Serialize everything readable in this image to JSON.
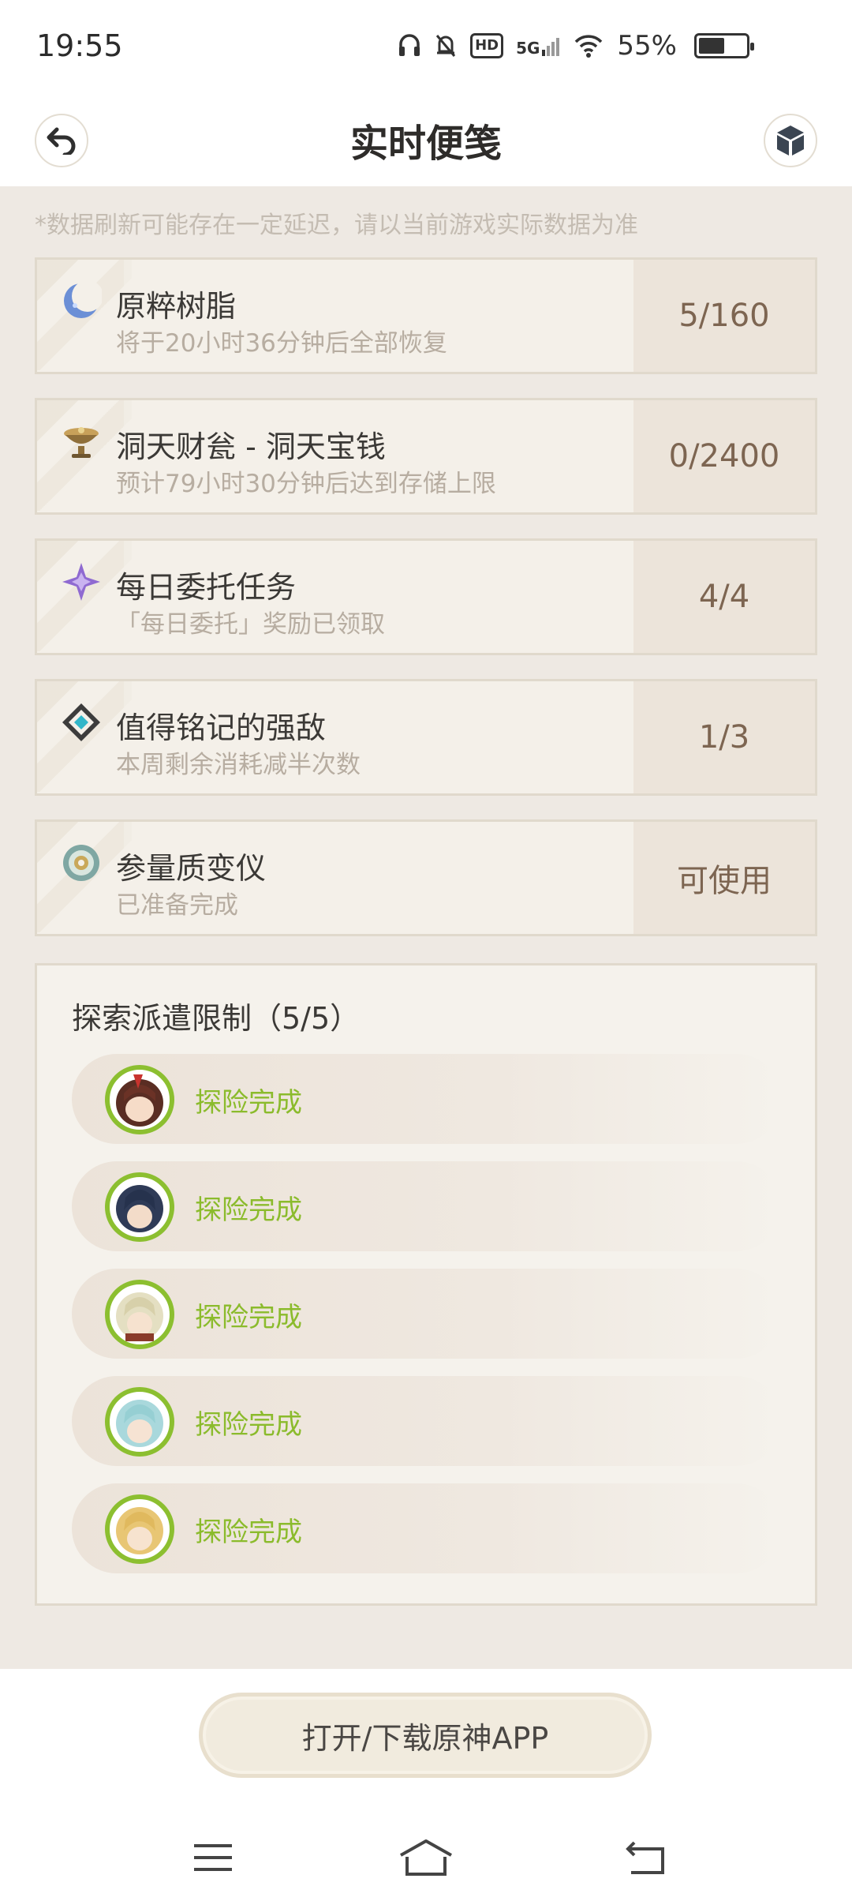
{
  "status_bar": {
    "time": "19:55",
    "network": "5G",
    "hd_label": "HD",
    "battery_percent": "55%",
    "battery_level": 0.55
  },
  "header": {
    "title": "实时便笺",
    "back_icon": "back-arrow-icon",
    "right_icon": "cube-icon"
  },
  "notice": "*数据刷新可能存在一定延迟，请以当前游戏实际数据为准",
  "cards": [
    {
      "title": "原粹树脂",
      "subtitle": "将于20小时36分钟后全部恢复",
      "value": "5/160",
      "icon": "resin-moon-icon"
    },
    {
      "title": "洞天财瓮 - 洞天宝钱",
      "subtitle": "预计79小时30分钟后达到存储上限",
      "value": "0/2400",
      "icon": "treasure-bowl-icon"
    },
    {
      "title": "每日委托任务",
      "subtitle": "「每日委托」奖励已领取",
      "value": "4/4",
      "icon": "commission-star-icon"
    },
    {
      "title": "值得铭记的强敌",
      "subtitle": "本周剩余消耗减半次数",
      "value": "1/3",
      "icon": "boss-diamond-icon"
    },
    {
      "title": "参量质变仪",
      "subtitle": "已准备完成",
      "value": "可使用",
      "icon": "transformer-gear-icon"
    }
  ],
  "expeditions": {
    "title": "探索派遣限制（5/5）",
    "items": [
      {
        "status": "探险完成",
        "avatar": "character-avatar-1"
      },
      {
        "status": "探险完成",
        "avatar": "character-avatar-2"
      },
      {
        "status": "探险完成",
        "avatar": "character-avatar-3"
      },
      {
        "status": "探险完成",
        "avatar": "character-avatar-4"
      },
      {
        "status": "探险完成",
        "avatar": "character-avatar-5"
      }
    ]
  },
  "open_app_button": "打开/下载原神APP",
  "colors": {
    "background": "#eee9e3",
    "card": "#f4f0e9",
    "value_panel": "#ece4da",
    "status_green": "#8bbb2c",
    "value_brown": "#7d6551"
  }
}
